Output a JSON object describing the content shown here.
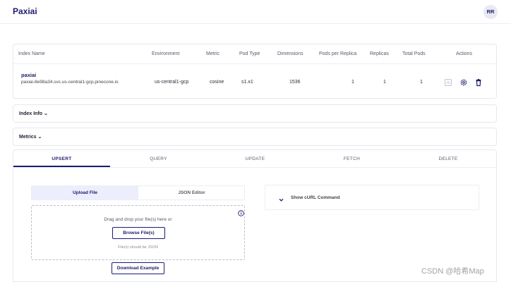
{
  "app": {
    "title": "Paxiai",
    "user_initials": "RR"
  },
  "index_table": {
    "headers": {
      "name": "Index Name",
      "environment": "Environment",
      "metric": "Metric",
      "pod_type": "Pod Type",
      "dimensions": "Dimensions",
      "pods_per_replica": "Pods per Replica",
      "replicas": "Replicas",
      "total_pods": "Total Pods",
      "actions": "Actions"
    },
    "row": {
      "name": "paxiai",
      "host": "paxiai-8e98a34.svc.us-central1-gcp.pinecone.io",
      "environment": "us-central1-gcp",
      "metric": "cosine",
      "pod_type": "s1.x1",
      "dimensions": "1536",
      "pods_per_replica": "1",
      "replicas": "1",
      "total_pods": "1"
    },
    "action_icons": [
      "collection-icon",
      "gear-icon",
      "trash-icon"
    ]
  },
  "sections": {
    "index_info": "Index Info",
    "metrics": "Metrics"
  },
  "ops_tabs": {
    "upsert": "UPSERT",
    "query": "QUERY",
    "update": "UPDATE",
    "fetch": "FETCH",
    "delete": "DELETE",
    "active": "UPSERT"
  },
  "upsert": {
    "mode_upload": "Upload File",
    "mode_json": "JSON Editor",
    "drop_text": "Drag and drop your file(s) here or",
    "browse_label": "Browse File(s)",
    "hint": "File(s) should be JSON",
    "download_label": "Download Example",
    "curl_label": "Show cURL Command"
  },
  "watermark": "CSDN @哈希Map",
  "colors": {
    "accent": "#1b1c6e",
    "active_tab_bg": "#eceefd",
    "border": "#e6e8ee"
  }
}
